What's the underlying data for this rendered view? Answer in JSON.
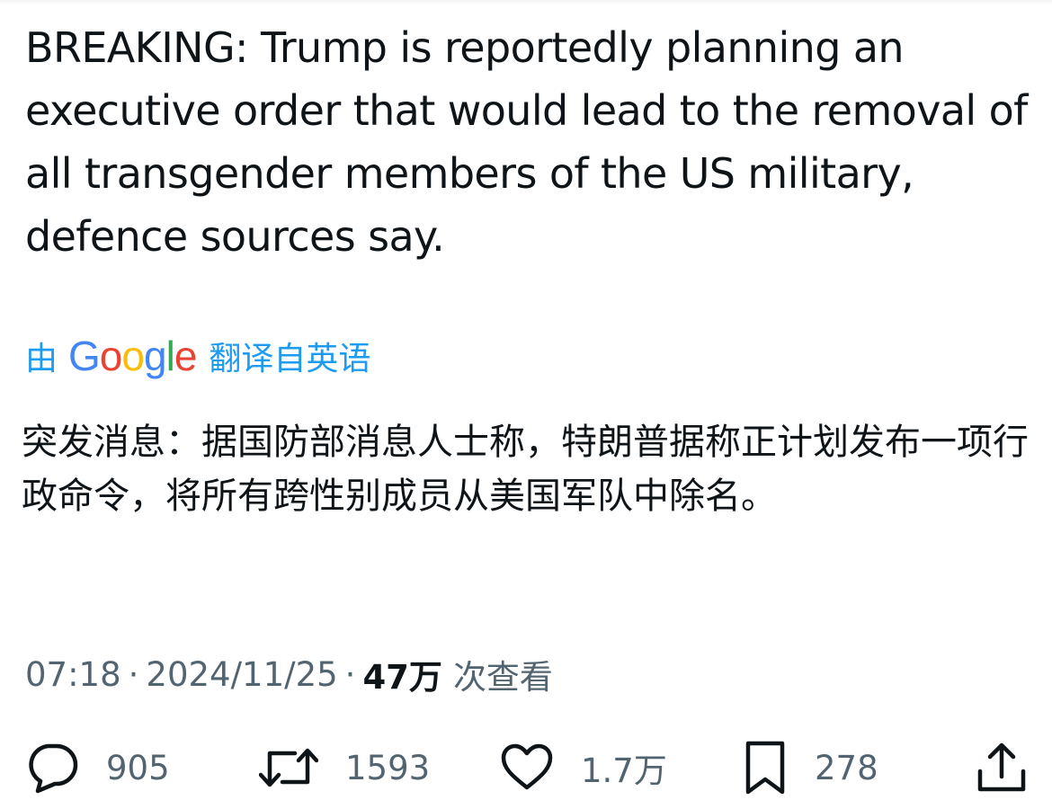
{
  "tweet": {
    "text": "BREAKING: Trump is reportedly planning an executive order that would lead to the removal of all transgender members of the US military, defence sources say.",
    "translation": {
      "prefix": "由",
      "provider": "Google",
      "suffix": "翻译自英语",
      "text": "突发消息：据国防部消息人士称，特朗普据称正计划发布一项行政命令，将所有跨性别成员从美国军队中除名。"
    },
    "meta": {
      "time": "07:18",
      "separator": "·",
      "date": "2024/11/25",
      "views": "47万",
      "views_label": "次查看"
    },
    "actions": {
      "replies": "905",
      "retweets": "1593",
      "likes": "1.7万",
      "bookmarks": "278"
    }
  },
  "colors": {
    "text": "#0f1419",
    "muted": "#536471",
    "link": "#1d9bf0",
    "google_blue": "#4285F4",
    "google_red": "#EA4335",
    "google_yellow": "#FBBC05",
    "google_green": "#34A853"
  },
  "icons": [
    "reply-icon",
    "retweet-icon",
    "like-icon",
    "bookmark-icon",
    "share-icon"
  ]
}
